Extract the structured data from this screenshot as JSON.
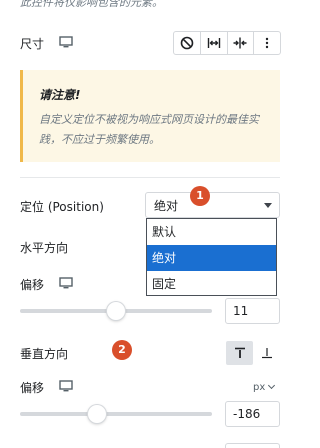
{
  "top_note": "此控件将仅影响包含的元素。",
  "size": {
    "label": "尺寸",
    "buttons": [
      "block-icon",
      "full-width-icon",
      "inline-icon",
      "more-vertical-icon"
    ]
  },
  "notice": {
    "title": "请注意!",
    "body": "自定义定位不被视为响应式网页设计的最佳实践，不应过于频繁使用。"
  },
  "position": {
    "label": "定位 (Position)",
    "selected": "绝对",
    "options": [
      "默认",
      "绝对",
      "固定"
    ],
    "badge": "1"
  },
  "horizontal": {
    "label": "水平方向",
    "offset_label": "偏移",
    "offset_value": "11",
    "slider_fraction": 0.5
  },
  "vertical": {
    "label": "垂直方向",
    "badge": "2",
    "align_buttons": [
      "align-top-icon",
      "align-bottom-icon"
    ],
    "active_button": "align-top-icon",
    "offset_label": "偏移",
    "unit": "px",
    "offset_value": "-186",
    "slider_fraction": 0.4
  },
  "colors": {
    "accent": "#1a6fd1",
    "badge": "#d94f2b",
    "notice_bg": "#fdf7e5",
    "notice_border": "#f0b849"
  }
}
